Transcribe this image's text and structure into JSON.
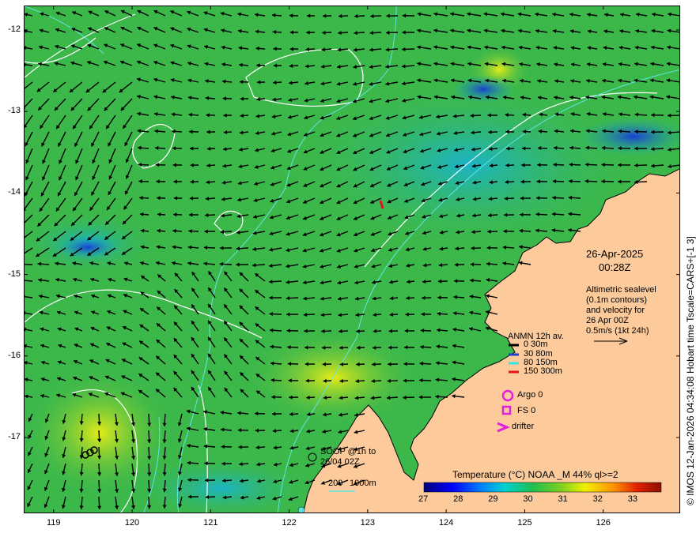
{
  "map": {
    "y_ticks": [
      "-12",
      "-13",
      "-14",
      "-15",
      "-16",
      "-17"
    ],
    "y_values": [
      -12,
      -13,
      -14,
      -15,
      -16,
      -17
    ],
    "x_ticks": [
      "119",
      "120",
      "121",
      "122",
      "123",
      "124",
      "125",
      "126"
    ],
    "x_values": [
      119,
      120,
      121,
      122,
      123,
      124,
      125,
      126
    ],
    "lon_range": [
      118.62,
      126.98
    ],
    "lat_range": [
      -17.93,
      -11.7
    ],
    "credit": "© IMOS 12-Jan-2026 04:34:08 Hobart time Tscale=CARS+[-1 3]",
    "colors": {
      "land": "#fcca9b",
      "sea_mid": "#3cb84a",
      "warm": "#d8e81e",
      "cool": "#1ab4b4",
      "cold": "#1a3fd0",
      "arrow": "#000000",
      "contour_white": "#ffffff",
      "isobath": "#5ee6e6"
    }
  },
  "date": {
    "day": "26-Apr-2025",
    "time": "00:28Z"
  },
  "altimetry": {
    "lines": [
      "Altimetric sealevel",
      "(0.1m contours)",
      "and velocity for",
      "26 Apr 00Z",
      "0.5m/s (1kt 24h)"
    ]
  },
  "anmn": {
    "title": "ANMN 12h av.",
    "items": [
      {
        "label": "0 30m",
        "color": "#000000"
      },
      {
        "label": "30 80m",
        "color": "#1a3fd0"
      },
      {
        "label": "80 150m",
        "color": "#2ee6e6"
      },
      {
        "label": "150 300m",
        "color": "#e8121a"
      }
    ]
  },
  "markers": {
    "argo": "Argo 0",
    "fs": "FS 0",
    "drifter": "drifter",
    "marker_color": "#e21ee0"
  },
  "soop": {
    "line1": "SOOP @1h to",
    "line2": "26/04 02Z"
  },
  "isobaths": {
    "label1": "200",
    "label2": "1000m"
  },
  "colorbar": {
    "title": "Temperature (°C) NOAA _M 44% ql>=2",
    "ticks": [
      "27",
      "28",
      "29",
      "30",
      "31",
      "32",
      "33"
    ],
    "range": [
      27,
      33.8
    ],
    "stops": [
      "#00007a",
      "#0000ff",
      "#0080ff",
      "#00d0d0",
      "#20c050",
      "#80d020",
      "#f0f000",
      "#ff9000",
      "#e02000",
      "#8b1000"
    ]
  }
}
